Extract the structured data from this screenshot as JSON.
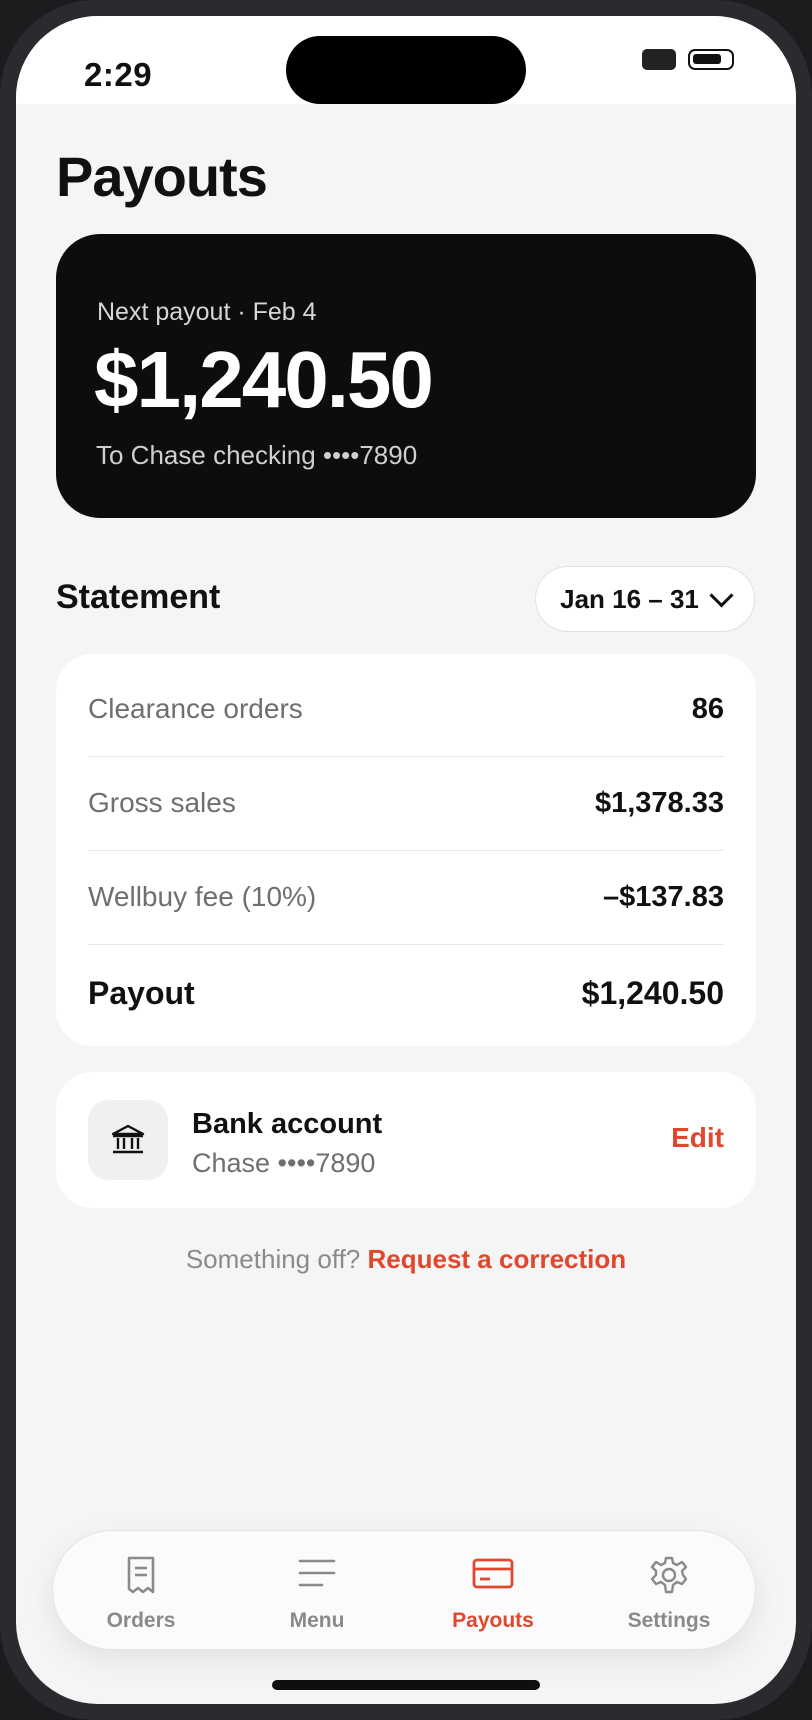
{
  "status_bar": {
    "time": "2:29"
  },
  "page": {
    "title": "Payouts"
  },
  "hero": {
    "label": "Next payout · Feb 4",
    "amount": "$1,240.50",
    "destination": "To Chase checking ••••7890"
  },
  "statement": {
    "title": "Statement",
    "range": "Jan 16 – 31",
    "rows": [
      {
        "label": "Clearance orders",
        "value": "86"
      },
      {
        "label": "Gross sales",
        "value": "$1,378.33"
      },
      {
        "label": "Wellbuy fee (10%)",
        "value": "–$137.83"
      }
    ],
    "total": {
      "label": "Payout",
      "value": "$1,240.50"
    }
  },
  "bank": {
    "icon": "bank-icon",
    "title": "Bank account",
    "subtitle": "Chase ••••7890",
    "edit_label": "Edit"
  },
  "correction": {
    "prompt": "Something off?",
    "link": "Request a correction"
  },
  "tabs": [
    {
      "label": "Orders",
      "icon": "receipt-icon",
      "active": false
    },
    {
      "label": "Menu",
      "icon": "menu-icon",
      "active": false
    },
    {
      "label": "Payouts",
      "icon": "card-icon",
      "active": true
    },
    {
      "label": "Settings",
      "icon": "gear-icon",
      "active": false
    }
  ],
  "colors": {
    "accent": "#e0472c",
    "hero_bg": "#0d0d0e",
    "page_bg": "#f5f5f5"
  }
}
